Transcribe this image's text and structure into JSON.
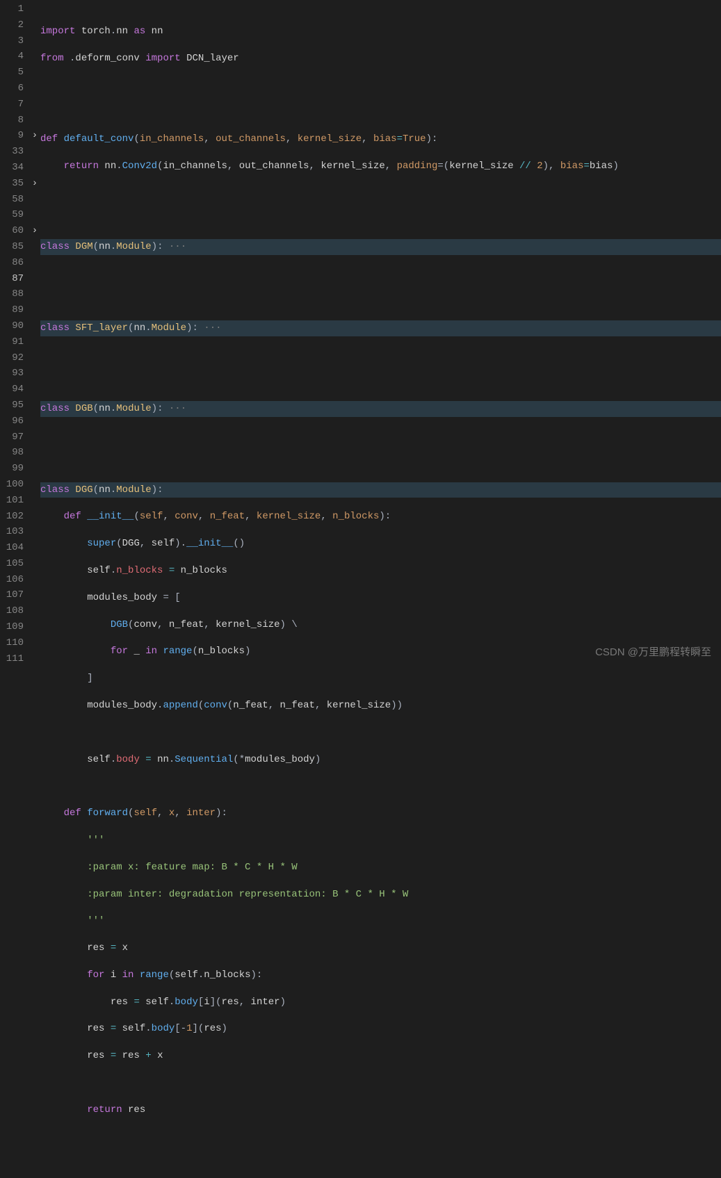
{
  "watermark": "CSDN @万里鹏程转瞬至",
  "lineNumbers": [
    "1",
    "2",
    "3",
    "4",
    "5",
    "6",
    "7",
    "8",
    "9",
    "33",
    "34",
    "35",
    "58",
    "59",
    "60",
    "85",
    "86",
    "87",
    "88",
    "89",
    "90",
    "91",
    "92",
    "93",
    "94",
    "95",
    "96",
    "97",
    "98",
    "99",
    "100",
    "101",
    "102",
    "103",
    "104",
    "105",
    "106",
    "107",
    "108",
    "109",
    "110",
    "111"
  ],
  "currentLine": "87",
  "folds": {
    "9": "›",
    "35": "›",
    "60": "›"
  },
  "code": {
    "l1": {
      "t1": "import",
      "t2": " torch",
      "t3": ".",
      "t4": "nn",
      "t5": " as ",
      "t6": "nn"
    },
    "l2": {
      "t1": "from",
      "t2": " .",
      "t3": "deform_conv",
      "t4": " import ",
      "t5": "DCN_layer"
    },
    "l5": {
      "t1": "def ",
      "t2": "default_conv",
      "t3": "(",
      "t4": "in_channels",
      "t5": ", ",
      "t6": "out_channels",
      "t7": ", ",
      "t8": "kernel_size",
      "t9": ", ",
      "t10": "bias",
      "t11": "=",
      "t12": "True",
      "t13": "):"
    },
    "l6": {
      "t1": "return ",
      "t2": "nn",
      "t3": ".",
      "t4": "Conv2d",
      "t5": "(",
      "t6": "in_channels",
      "t7": ", ",
      "t8": "out_channels",
      "t9": ", ",
      "t10": "kernel_size",
      "t11": ", ",
      "t12": "padding",
      "t13": "=(",
      "t14": "kernel_size",
      "t15": " // ",
      "t16": "2",
      "t17": "), ",
      "t18": "bias",
      "t19": "=",
      "t20": "bias",
      "t21": ")"
    },
    "l9": {
      "t1": "class ",
      "t2": "DGM",
      "t3": "(",
      "t4": "nn",
      "t5": ".",
      "t6": "Module",
      "t7": "):",
      "t8": " ···"
    },
    "l35": {
      "t1": "class ",
      "t2": "SFT_layer",
      "t3": "(",
      "t4": "nn",
      "t5": ".",
      "t6": "Module",
      "t7": "):",
      "t8": " ···"
    },
    "l60": {
      "t1": "class ",
      "t2": "DGB",
      "t3": "(",
      "t4": "nn",
      "t5": ".",
      "t6": "Module",
      "t7": "):",
      "t8": " ···"
    },
    "l87": {
      "t1": "class ",
      "t2": "DGG",
      "t3": "(",
      "t4": "nn",
      "t5": ".",
      "t6": "Module",
      "t7": "):"
    },
    "l88": {
      "t1": "def ",
      "t2": "__init__",
      "t3": "(",
      "t4": "self",
      "t5": ", ",
      "t6": "conv",
      "t7": ", ",
      "t8": "n_feat",
      "t9": ", ",
      "t10": "kernel_size",
      "t11": ", ",
      "t12": "n_blocks",
      "t13": "):"
    },
    "l89": {
      "t1": "super",
      "t2": "(",
      "t3": "DGG",
      "t4": ", ",
      "t5": "self",
      "t6": ").",
      "t7": "__init__",
      "t8": "()"
    },
    "l90": {
      "t1": "self",
      "t2": ".",
      "t3": "n_blocks",
      "t4": " = ",
      "t5": "n_blocks"
    },
    "l91": {
      "t1": "modules_body",
      "t2": " = ["
    },
    "l92": {
      "t1": "DGB",
      "t2": "(",
      "t3": "conv",
      "t4": ", ",
      "t5": "n_feat",
      "t6": ", ",
      "t7": "kernel_size",
      "t8": ") \\"
    },
    "l93": {
      "t1": "for ",
      "t2": "_",
      "t3": " in ",
      "t4": "range",
      "t5": "(",
      "t6": "n_blocks",
      "t7": ")"
    },
    "l94": {
      "t1": "]"
    },
    "l95": {
      "t1": "modules_body",
      "t2": ".",
      "t3": "append",
      "t4": "(",
      "t5": "conv",
      "t6": "(",
      "t7": "n_feat",
      "t8": ", ",
      "t9": "n_feat",
      "t10": ", ",
      "t11": "kernel_size",
      "t12": "))"
    },
    "l97": {
      "t1": "self",
      "t2": ".",
      "t3": "body",
      "t4": " = ",
      "t5": "nn",
      "t6": ".",
      "t7": "Sequential",
      "t8": "(*",
      "t9": "modules_body",
      "t10": ")"
    },
    "l99": {
      "t1": "def ",
      "t2": "forward",
      "t3": "(",
      "t4": "self",
      "t5": ", ",
      "t6": "x",
      "t7": ", ",
      "t8": "inter",
      "t9": "):"
    },
    "l100": {
      "t1": "'''"
    },
    "l101": {
      "t1": ":param x: feature map: B * C * H * W"
    },
    "l102": {
      "t1": ":param inter: degradation representation: B * C * H * W"
    },
    "l103": {
      "t1": "'''"
    },
    "l104": {
      "t1": "res",
      "t2": " = ",
      "t3": "x"
    },
    "l105": {
      "t1": "for ",
      "t2": "i",
      "t3": " in ",
      "t4": "range",
      "t5": "(",
      "t6": "self",
      "t7": ".",
      "t8": "n_blocks",
      "t9": "):"
    },
    "l106": {
      "t1": "res",
      "t2": " = ",
      "t3": "self",
      "t4": ".",
      "t5": "body",
      "t6": "[",
      "t7": "i",
      "t8": "](",
      "t9": "res",
      "t10": ", ",
      "t11": "inter",
      "t12": ")"
    },
    "l107": {
      "t1": "res",
      "t2": " = ",
      "t3": "self",
      "t4": ".",
      "t5": "body",
      "t6": "[-",
      "t7": "1",
      "t8": "](",
      "t9": "res",
      "t10": ")"
    },
    "l108": {
      "t1": "res",
      "t2": " = ",
      "t3": "res",
      "t4": " + ",
      "t5": "x"
    },
    "l110": {
      "t1": "return ",
      "t2": "res"
    }
  }
}
